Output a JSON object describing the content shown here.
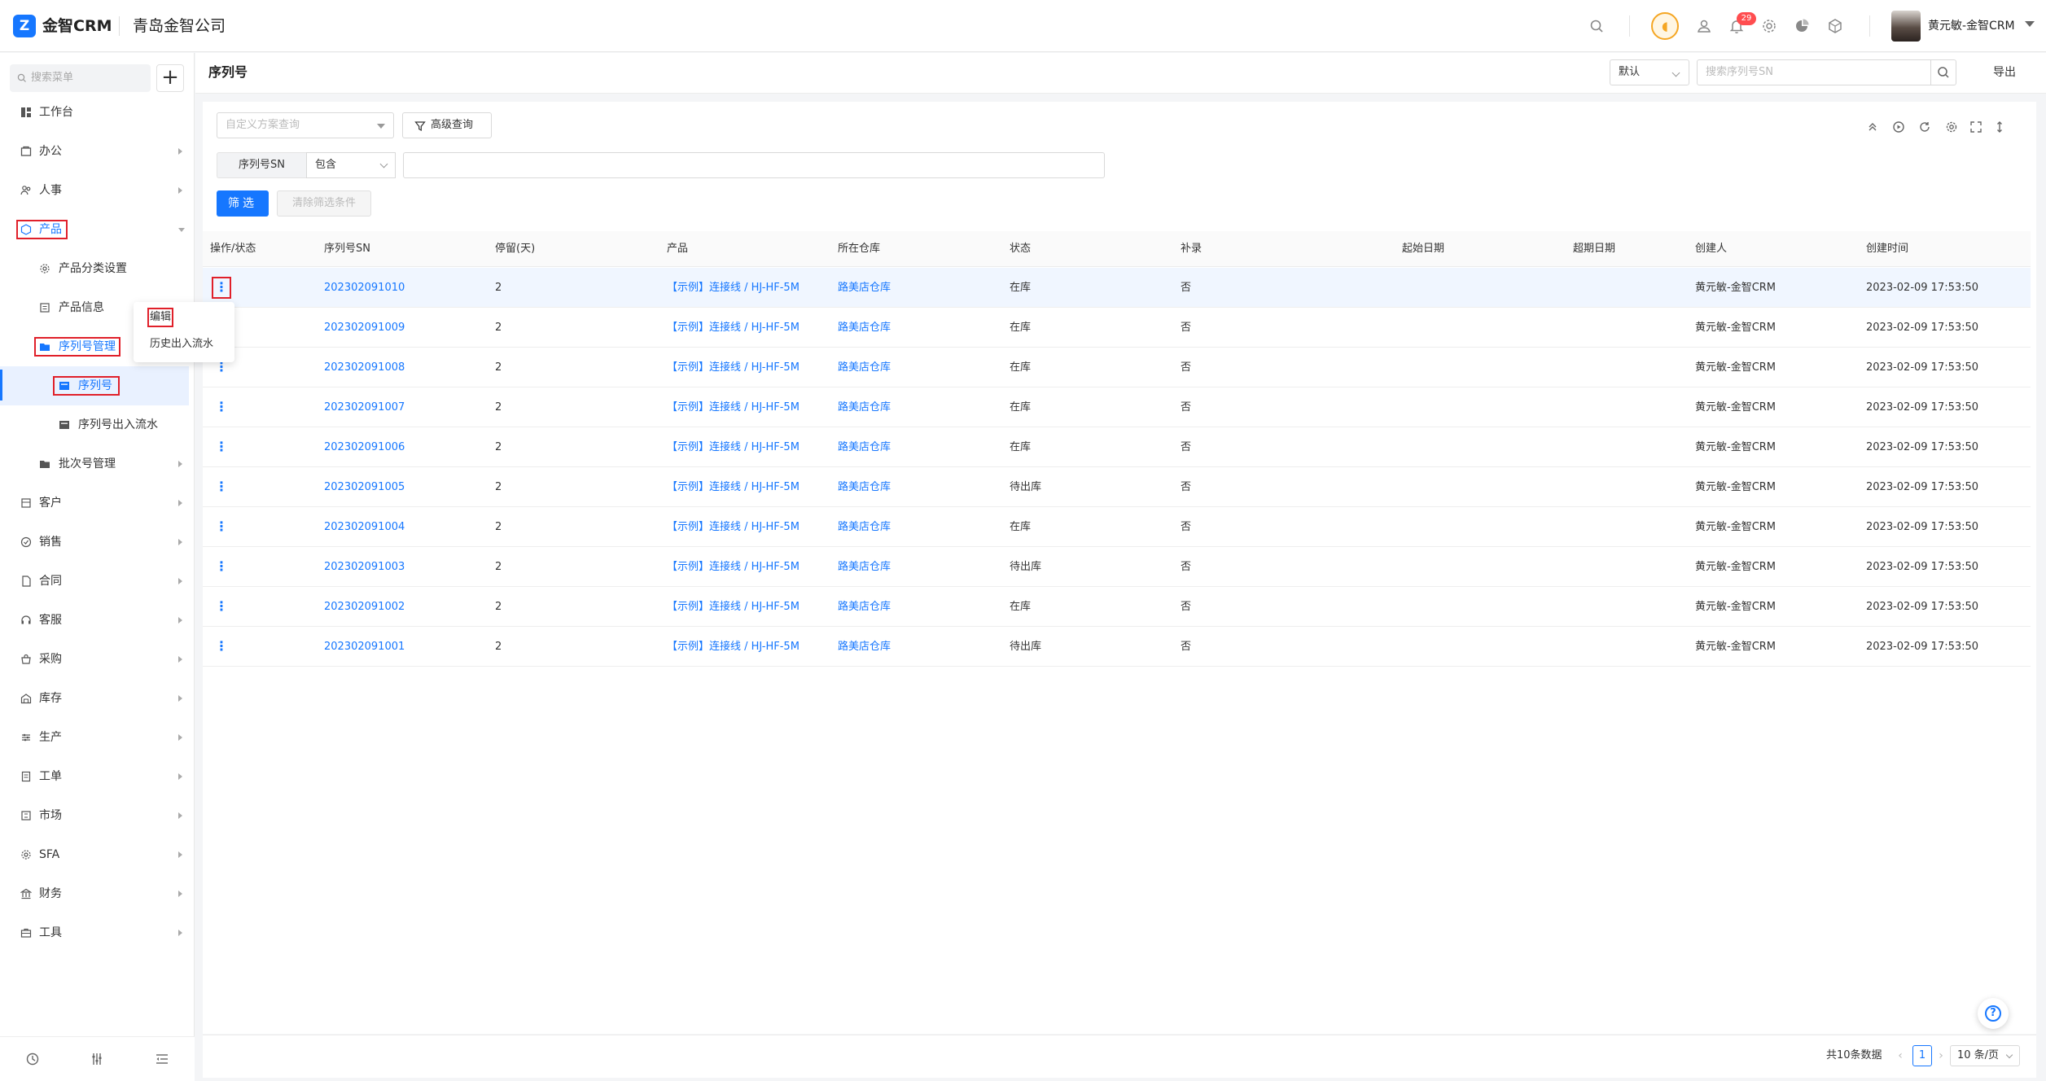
{
  "app": {
    "logo_text": "金智CRM",
    "company": "青岛金智公司",
    "user_name": "黄元敏-金智CRM",
    "notification_count": "29"
  },
  "sidebar": {
    "search_placeholder": "搜索菜单",
    "items": [
      {
        "label": "工作台",
        "icon": "dashboard-icon"
      },
      {
        "label": "办公",
        "icon": "office-icon"
      },
      {
        "label": "人事",
        "icon": "people-icon"
      },
      {
        "label": "产品",
        "icon": "product-icon"
      },
      {
        "label": "产品分类设置",
        "icon": "settings-icon"
      },
      {
        "label": "产品信息",
        "icon": "info-icon"
      },
      {
        "label": "序列号管理",
        "icon": "folder-icon"
      },
      {
        "label": "序列号",
        "icon": "list-icon"
      },
      {
        "label": "序列号出入流水",
        "icon": "list-icon"
      },
      {
        "label": "批次号管理",
        "icon": "folder-icon"
      },
      {
        "label": "客户",
        "icon": "customer-icon"
      },
      {
        "label": "销售",
        "icon": "sales-icon"
      },
      {
        "label": "合同",
        "icon": "contract-icon"
      },
      {
        "label": "客服",
        "icon": "service-icon"
      },
      {
        "label": "采购",
        "icon": "purchase-icon"
      },
      {
        "label": "库存",
        "icon": "inventory-icon"
      },
      {
        "label": "生产",
        "icon": "production-icon"
      },
      {
        "label": "工单",
        "icon": "workorder-icon"
      },
      {
        "label": "市场",
        "icon": "market-icon"
      },
      {
        "label": "SFA",
        "icon": "sfa-icon"
      },
      {
        "label": "财务",
        "icon": "finance-icon"
      },
      {
        "label": "工具",
        "icon": "tools-icon"
      }
    ]
  },
  "header": {
    "title": "序列号",
    "view_select": "默认",
    "search_placeholder": "搜索序列号SN",
    "export_label": "导出"
  },
  "filters": {
    "scheme_placeholder": "自定义方案查询",
    "advanced_label": "高级查询",
    "field_label": "序列号SN",
    "operator": "包含",
    "value": "",
    "filter_button": "筛选",
    "clear_button": "清除筛选条件"
  },
  "table": {
    "columns": [
      "操作/状态",
      "序列号SN",
      "停留(天)",
      "产品",
      "所在仓库",
      "状态",
      "补录",
      "起始日期",
      "超期日期",
      "创建人",
      "创建时间"
    ],
    "rows": [
      {
        "sn": "202302091010",
        "days": "2",
        "product": "【示例】连接线 / HJ-HF-5M",
        "warehouse": "路美店仓库",
        "status": "在库",
        "supplement": "否",
        "start": "",
        "expire": "",
        "creator": "黄元敏-金智CRM",
        "created": "2023-02-09 17:53:50"
      },
      {
        "sn": "202302091009",
        "days": "2",
        "product": "【示例】连接线 / HJ-HF-5M",
        "warehouse": "路美店仓库",
        "status": "在库",
        "supplement": "否",
        "start": "",
        "expire": "",
        "creator": "黄元敏-金智CRM",
        "created": "2023-02-09 17:53:50"
      },
      {
        "sn": "202302091008",
        "days": "2",
        "product": "【示例】连接线 / HJ-HF-5M",
        "warehouse": "路美店仓库",
        "status": "在库",
        "supplement": "否",
        "start": "",
        "expire": "",
        "creator": "黄元敏-金智CRM",
        "created": "2023-02-09 17:53:50"
      },
      {
        "sn": "202302091007",
        "days": "2",
        "product": "【示例】连接线 / HJ-HF-5M",
        "warehouse": "路美店仓库",
        "status": "在库",
        "supplement": "否",
        "start": "",
        "expire": "",
        "creator": "黄元敏-金智CRM",
        "created": "2023-02-09 17:53:50"
      },
      {
        "sn": "202302091006",
        "days": "2",
        "product": "【示例】连接线 / HJ-HF-5M",
        "warehouse": "路美店仓库",
        "status": "在库",
        "supplement": "否",
        "start": "",
        "expire": "",
        "creator": "黄元敏-金智CRM",
        "created": "2023-02-09 17:53:50"
      },
      {
        "sn": "202302091005",
        "days": "2",
        "product": "【示例】连接线 / HJ-HF-5M",
        "warehouse": "路美店仓库",
        "status": "待出库",
        "supplement": "否",
        "start": "",
        "expire": "",
        "creator": "黄元敏-金智CRM",
        "created": "2023-02-09 17:53:50"
      },
      {
        "sn": "202302091004",
        "days": "2",
        "product": "【示例】连接线 / HJ-HF-5M",
        "warehouse": "路美店仓库",
        "status": "在库",
        "supplement": "否",
        "start": "",
        "expire": "",
        "creator": "黄元敏-金智CRM",
        "created": "2023-02-09 17:53:50"
      },
      {
        "sn": "202302091003",
        "days": "2",
        "product": "【示例】连接线 / HJ-HF-5M",
        "warehouse": "路美店仓库",
        "status": "待出库",
        "supplement": "否",
        "start": "",
        "expire": "",
        "creator": "黄元敏-金智CRM",
        "created": "2023-02-09 17:53:50"
      },
      {
        "sn": "202302091002",
        "days": "2",
        "product": "【示例】连接线 / HJ-HF-5M",
        "warehouse": "路美店仓库",
        "status": "在库",
        "supplement": "否",
        "start": "",
        "expire": "",
        "creator": "黄元敏-金智CRM",
        "created": "2023-02-09 17:53:50"
      },
      {
        "sn": "202302091001",
        "days": "2",
        "product": "【示例】连接线 / HJ-HF-5M",
        "warehouse": "路美店仓库",
        "status": "待出库",
        "supplement": "否",
        "start": "",
        "expire": "",
        "creator": "黄元敏-金智CRM",
        "created": "2023-02-09 17:53:50"
      }
    ]
  },
  "row_menu": {
    "items": [
      "编辑",
      "历史出入流水"
    ]
  },
  "pagination": {
    "total": "共10条数据",
    "current": "1",
    "page_size": "10 条/页"
  },
  "colors": {
    "accent": "#1677ff",
    "highlight": "#e0202a"
  }
}
